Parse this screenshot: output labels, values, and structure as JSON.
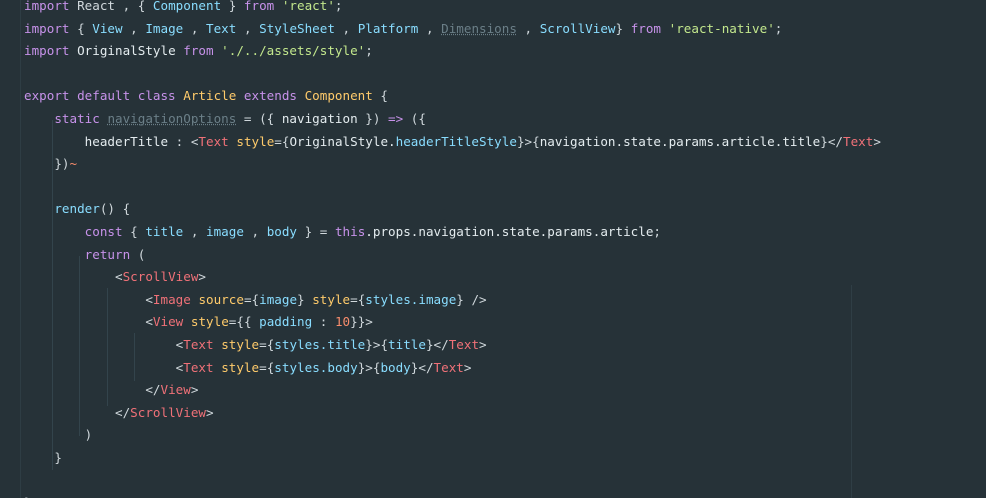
{
  "editor": {
    "language": "javascript-jsx",
    "theme_colors": {
      "background": "#263238",
      "keyword": "#c792ea",
      "class": "#ffcb6b",
      "string": "#c3e88d",
      "tag": "#f07178",
      "property": "#89ddff",
      "number": "#f78c6c",
      "text": "#e4ecef"
    },
    "lines": [
      {
        "indent": 0,
        "tokens": [
          [
            "kw",
            "import"
          ],
          [
            "pun",
            " React , { "
          ],
          [
            "prop",
            "Component"
          ],
          [
            "pun",
            " } "
          ],
          [
            "kw",
            "from"
          ],
          [
            "pun",
            " "
          ],
          [
            "str",
            "'react'"
          ],
          [
            "pun",
            ";"
          ]
        ]
      },
      {
        "indent": 0,
        "tokens": [
          [
            "kw",
            "import"
          ],
          [
            "pun",
            " { "
          ],
          [
            "prop",
            "View"
          ],
          [
            "pun",
            " , "
          ],
          [
            "prop",
            "Image"
          ],
          [
            "pun",
            " , "
          ],
          [
            "prop",
            "Text"
          ],
          [
            "pun",
            " , "
          ],
          [
            "prop",
            "StyleSheet"
          ],
          [
            "pun",
            " , "
          ],
          [
            "prop",
            "Platform"
          ],
          [
            "pun",
            " , "
          ],
          [
            "dim",
            "Dimensions"
          ],
          [
            "pun",
            " , "
          ],
          [
            "prop",
            "ScrollView"
          ],
          [
            "pun",
            "} "
          ],
          [
            "kw",
            "from"
          ],
          [
            "pun",
            " "
          ],
          [
            "str",
            "'react-native'"
          ],
          [
            "pun",
            ";"
          ]
        ]
      },
      {
        "indent": 0,
        "tokens": [
          [
            "kw",
            "import"
          ],
          [
            "plain",
            " OriginalStyle "
          ],
          [
            "kw",
            "from"
          ],
          [
            "pun",
            " "
          ],
          [
            "str",
            "'./../assets/style'"
          ],
          [
            "pun",
            ";"
          ]
        ]
      },
      {
        "indent": 0,
        "tokens": []
      },
      {
        "indent": 0,
        "tokens": [
          [
            "kw",
            "export default class"
          ],
          [
            "pun",
            " "
          ],
          [
            "cls",
            "Article"
          ],
          [
            "pun",
            " "
          ],
          [
            "kw",
            "extends"
          ],
          [
            "pun",
            " "
          ],
          [
            "cls",
            "Component"
          ],
          [
            "pun",
            " {"
          ]
        ]
      },
      {
        "indent": 1,
        "tokens": [
          [
            "kw",
            "static"
          ],
          [
            "pun",
            " "
          ],
          [
            "dim",
            "navigationOptions"
          ],
          [
            "pun",
            " = ({ "
          ],
          [
            "plain",
            "navigation"
          ],
          [
            "pun",
            " }) "
          ],
          [
            "kw",
            "=>"
          ],
          [
            "pun",
            " ({"
          ]
        ]
      },
      {
        "indent": 2,
        "tokens": [
          [
            "plain",
            "headerTitle"
          ],
          [
            "pun",
            " : <"
          ],
          [
            "tag",
            "Text"
          ],
          [
            "pun",
            " "
          ],
          [
            "attr",
            "style"
          ],
          [
            "pun",
            "={"
          ],
          [
            "plain",
            "OriginalStyle."
          ],
          [
            "prop",
            "headerTitleStyle"
          ],
          [
            "pun",
            "}>{"
          ],
          [
            "plain",
            "navigation.state.params.article.title"
          ],
          [
            "pun",
            "}</"
          ],
          [
            "tag",
            "Text"
          ],
          [
            "pun",
            ">"
          ]
        ]
      },
      {
        "indent": 1,
        "tokens": [
          [
            "pun",
            "})"
          ],
          [
            "squiggle",
            "~"
          ]
        ]
      },
      {
        "indent": 0,
        "tokens": []
      },
      {
        "indent": 1,
        "tokens": [
          [
            "prop",
            "render"
          ],
          [
            "pun",
            "() {"
          ]
        ]
      },
      {
        "indent": 2,
        "tokens": [
          [
            "kw",
            "const"
          ],
          [
            "pun",
            " { "
          ],
          [
            "prop",
            "title"
          ],
          [
            "pun",
            " , "
          ],
          [
            "prop",
            "image"
          ],
          [
            "pun",
            " , "
          ],
          [
            "prop",
            "body"
          ],
          [
            "pun",
            " } = "
          ],
          [
            "kw",
            "this"
          ],
          [
            "plain",
            ".props.navigation.state.params.article"
          ],
          [
            "pun",
            ";"
          ]
        ]
      },
      {
        "indent": 2,
        "tokens": [
          [
            "kw",
            "return"
          ],
          [
            "pun",
            " ("
          ]
        ]
      },
      {
        "indent": 3,
        "tokens": [
          [
            "pun",
            "<"
          ],
          [
            "tag",
            "ScrollView"
          ],
          [
            "pun",
            ">"
          ]
        ]
      },
      {
        "indent": 4,
        "tokens": [
          [
            "pun",
            "<"
          ],
          [
            "tag",
            "Image"
          ],
          [
            "pun",
            " "
          ],
          [
            "attr",
            "source"
          ],
          [
            "pun",
            "={"
          ],
          [
            "prop",
            "image"
          ],
          [
            "pun",
            "} "
          ],
          [
            "attr",
            "style"
          ],
          [
            "pun",
            "={"
          ],
          [
            "prop",
            "styles.image"
          ],
          [
            "pun",
            "} />"
          ]
        ]
      },
      {
        "indent": 4,
        "tokens": [
          [
            "pun",
            "<"
          ],
          [
            "tag",
            "View"
          ],
          [
            "pun",
            " "
          ],
          [
            "attr",
            "style"
          ],
          [
            "pun",
            "={{ "
          ],
          [
            "prop",
            "padding"
          ],
          [
            "pun",
            " : "
          ],
          [
            "num",
            "10"
          ],
          [
            "pun",
            "}}>"
          ]
        ]
      },
      {
        "indent": 5,
        "tokens": [
          [
            "pun",
            "<"
          ],
          [
            "tag",
            "Text"
          ],
          [
            "pun",
            " "
          ],
          [
            "attr",
            "style"
          ],
          [
            "pun",
            "={"
          ],
          [
            "prop",
            "styles.title"
          ],
          [
            "pun",
            "}>{"
          ],
          [
            "prop",
            "title"
          ],
          [
            "pun",
            "}</"
          ],
          [
            "tag",
            "Text"
          ],
          [
            "pun",
            ">"
          ]
        ]
      },
      {
        "indent": 5,
        "tokens": [
          [
            "pun",
            "<"
          ],
          [
            "tag",
            "Text"
          ],
          [
            "pun",
            " "
          ],
          [
            "attr",
            "style"
          ],
          [
            "pun",
            "={"
          ],
          [
            "prop",
            "styles.body"
          ],
          [
            "pun",
            "}>{"
          ],
          [
            "prop",
            "body"
          ],
          [
            "pun",
            "}</"
          ],
          [
            "tag",
            "Text"
          ],
          [
            "pun",
            ">"
          ]
        ]
      },
      {
        "indent": 4,
        "tokens": [
          [
            "pun",
            "</"
          ],
          [
            "tag",
            "View"
          ],
          [
            "pun",
            ">"
          ]
        ]
      },
      {
        "indent": 3,
        "tokens": [
          [
            "pun",
            "</"
          ],
          [
            "tag",
            "ScrollView"
          ],
          [
            "pun",
            ">"
          ]
        ]
      },
      {
        "indent": 2,
        "tokens": [
          [
            "pun",
            ")"
          ]
        ]
      },
      {
        "indent": 1,
        "tokens": [
          [
            "pun",
            "}"
          ]
        ]
      },
      {
        "indent": 0,
        "tokens": []
      },
      {
        "indent": 0,
        "tokens": [
          [
            "pun",
            "}"
          ]
        ]
      }
    ]
  }
}
